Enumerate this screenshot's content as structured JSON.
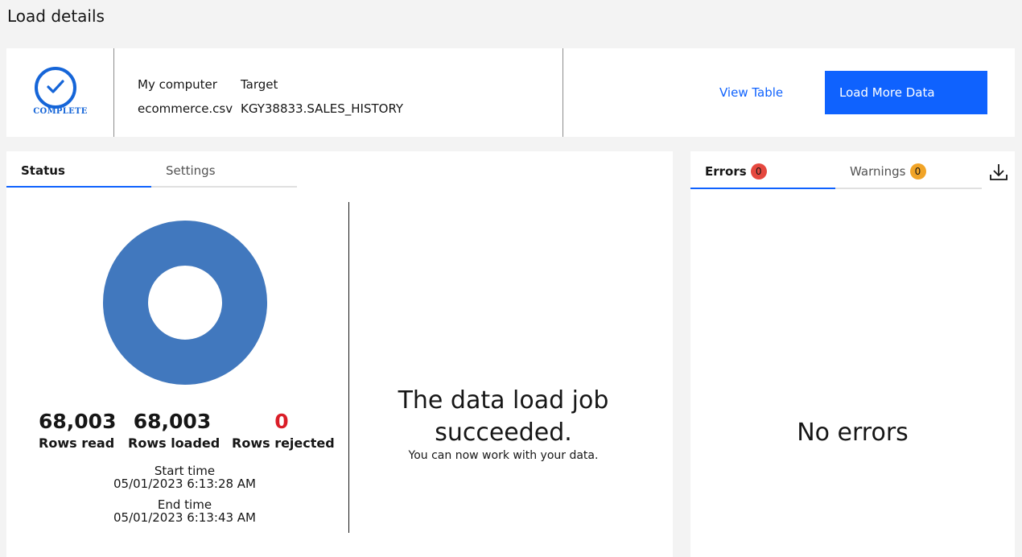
{
  "page": {
    "title": "Load details"
  },
  "summary": {
    "status": {
      "label": "COMPLETE",
      "icon": "checkmark-icon",
      "color": "#1565d8"
    },
    "source": {
      "header": "My computer",
      "value": "ecommerce.csv"
    },
    "target": {
      "header": "Target",
      "value": "KGY38833.SALES_HISTORY"
    },
    "view_table_label": "View Table",
    "load_more_label": "Load More Data"
  },
  "status_panel": {
    "tabs": [
      {
        "label": "Status",
        "selected": true
      },
      {
        "label": "Settings",
        "selected": false
      }
    ],
    "donut": {
      "loaded_fraction": 1.0,
      "color": "#4178be"
    },
    "stats": {
      "rows_read": {
        "value": "68,003",
        "label": "Rows read"
      },
      "rows_loaded": {
        "value": "68,003",
        "label": "Rows loaded"
      },
      "rows_rejected": {
        "value": "0",
        "label": "Rows rejected"
      }
    },
    "start": {
      "label": "Start time",
      "value": "05/01/2023 6:13:28 AM"
    },
    "end": {
      "label": "End time",
      "value": "05/01/2023 6:13:43 AM"
    },
    "message": {
      "title": "The data load job succeeded.",
      "subtitle": "You can now work with your data."
    }
  },
  "issues_panel": {
    "tabs": [
      {
        "label": "Errors",
        "count": "0",
        "badge_color": "#e5483f",
        "selected": true
      },
      {
        "label": "Warnings",
        "count": "0",
        "badge_color": "#f1a427",
        "selected": false
      }
    ],
    "download_icon": "download-icon",
    "empty_message": "No errors"
  }
}
